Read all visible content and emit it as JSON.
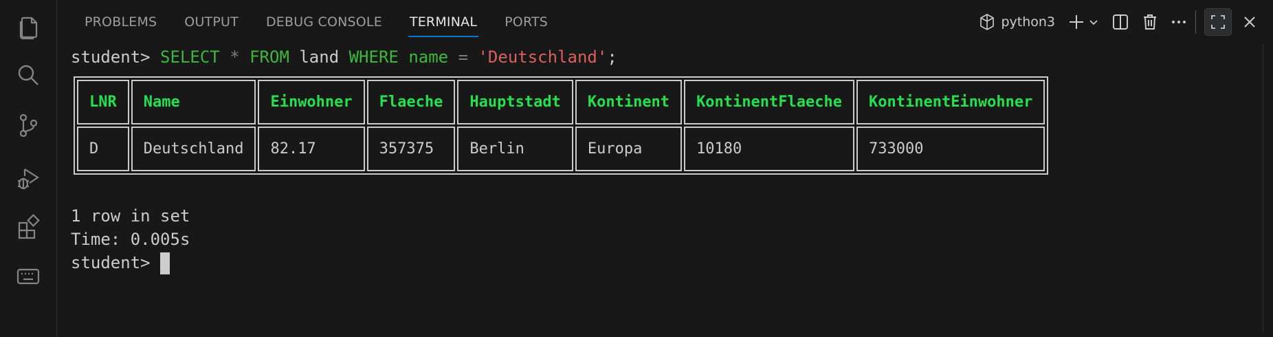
{
  "activity_bar": {
    "icons": [
      "files-icon",
      "search-icon",
      "source-control-icon",
      "run-debug-icon",
      "extensions-icon",
      "keyboard-icon"
    ]
  },
  "panel": {
    "tabs": [
      {
        "label": "PROBLEMS",
        "active": false
      },
      {
        "label": "OUTPUT",
        "active": false
      },
      {
        "label": "DEBUG CONSOLE",
        "active": false
      },
      {
        "label": "TERMINAL",
        "active": true
      },
      {
        "label": "PORTS",
        "active": false
      }
    ],
    "terminal_profile": "python3"
  },
  "terminal": {
    "prompt": "student>",
    "command": {
      "kw_select": "SELECT",
      "star": "*",
      "kw_from": "FROM",
      "table": "land",
      "kw_where": "WHERE",
      "column": "name",
      "eq": "=",
      "value": "'Deutschland'",
      "semicolon": ";"
    },
    "table": {
      "headers": [
        "LNR",
        "Name",
        "Einwohner",
        "Flaeche",
        "Hauptstadt",
        "Kontinent",
        "KontinentFlaeche",
        "KontinentEinwohner"
      ],
      "rows": [
        [
          "D",
          "Deutschland",
          "82.17",
          "357375",
          "Berlin",
          "Europa",
          "10180",
          "733000"
        ]
      ]
    },
    "summary": "1 row in set",
    "time": "Time: 0.005s",
    "final_prompt": "student>"
  },
  "colors": {
    "keyword": "#3db83d",
    "string": "#d9605e",
    "header": "#25e04e",
    "accent": "#0078d4"
  }
}
